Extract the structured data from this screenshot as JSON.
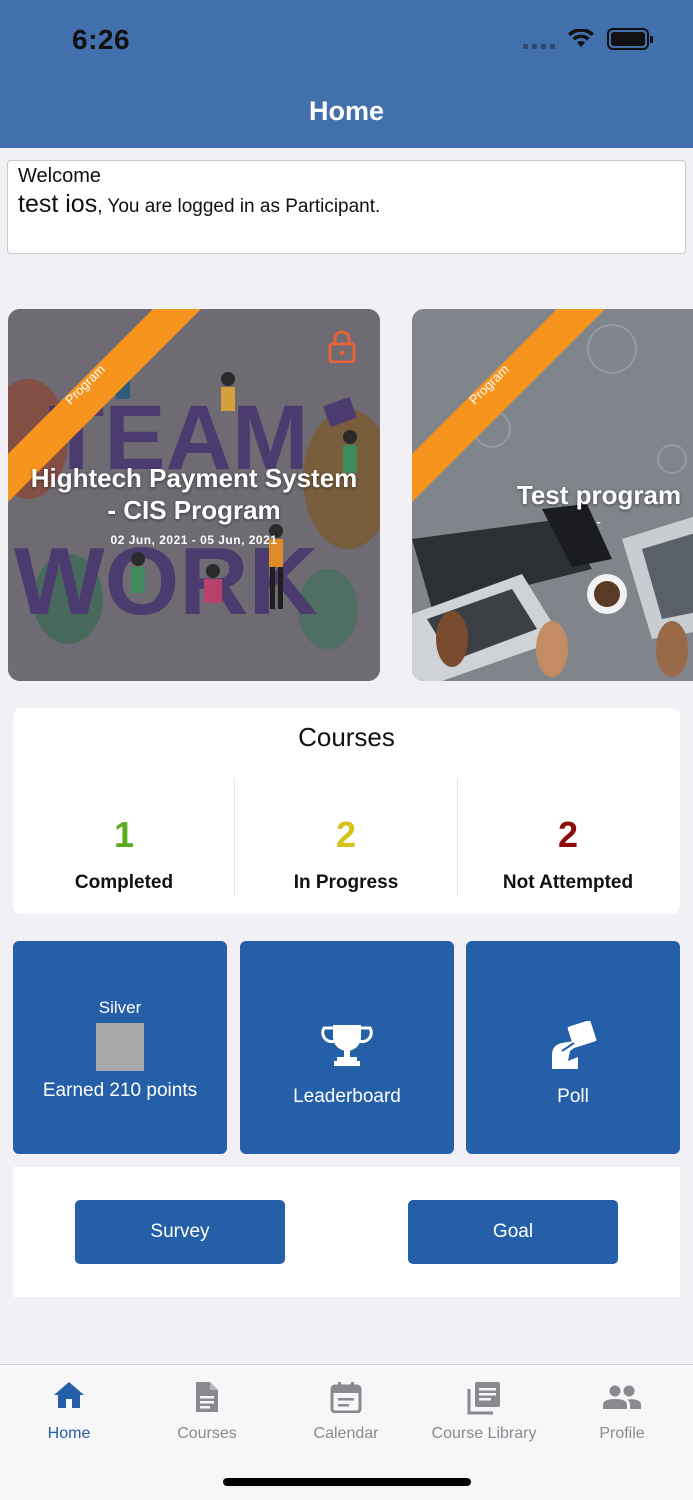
{
  "status_bar": {
    "time": "6:26"
  },
  "header": {
    "title": "Home"
  },
  "welcome": {
    "greeting": "Welcome",
    "user_name": "test ios",
    "role_text": ", You are logged in as Participant."
  },
  "programs": [
    {
      "ribbon": "Program",
      "title_line1": "Hightech Payment System",
      "title_line2": "- CIS Program",
      "dates": "02 Jun, 2021  -  05 Jun, 2021",
      "locked": true,
      "lock_icon": "lock-icon",
      "lock_color": "#e8623a"
    },
    {
      "ribbon": "Program",
      "title": "Test program",
      "dates": "-"
    }
  ],
  "courses": {
    "title": "Courses",
    "stats": [
      {
        "value": "1",
        "label": "Completed",
        "color": "#5aad1f"
      },
      {
        "value": "2",
        "label": "In Progress",
        "color": "#d5c21b"
      },
      {
        "value": "2",
        "label": "Not Attempted",
        "color": "#8b0a0a"
      }
    ]
  },
  "tiles": {
    "badge": {
      "rank": "Silver",
      "points": "Earned 210 points"
    },
    "leaderboard": {
      "label": "Leaderboard",
      "icon": "trophy-icon"
    },
    "poll": {
      "label": "Poll",
      "icon": "poll-hand-icon"
    }
  },
  "actions": {
    "survey": "Survey",
    "goal": "Goal"
  },
  "tabbar": [
    {
      "label": "Home",
      "icon": "home-icon",
      "active": true
    },
    {
      "label": "Courses",
      "icon": "document-icon"
    },
    {
      "label": "Calendar",
      "icon": "calendar-icon"
    },
    {
      "label": "Course Library",
      "icon": "library-icon"
    },
    {
      "label": "Profile",
      "icon": "people-icon"
    }
  ],
  "colors": {
    "header": "#4170ac",
    "accent": "#245fa7",
    "ribbon": "#f7941d"
  }
}
